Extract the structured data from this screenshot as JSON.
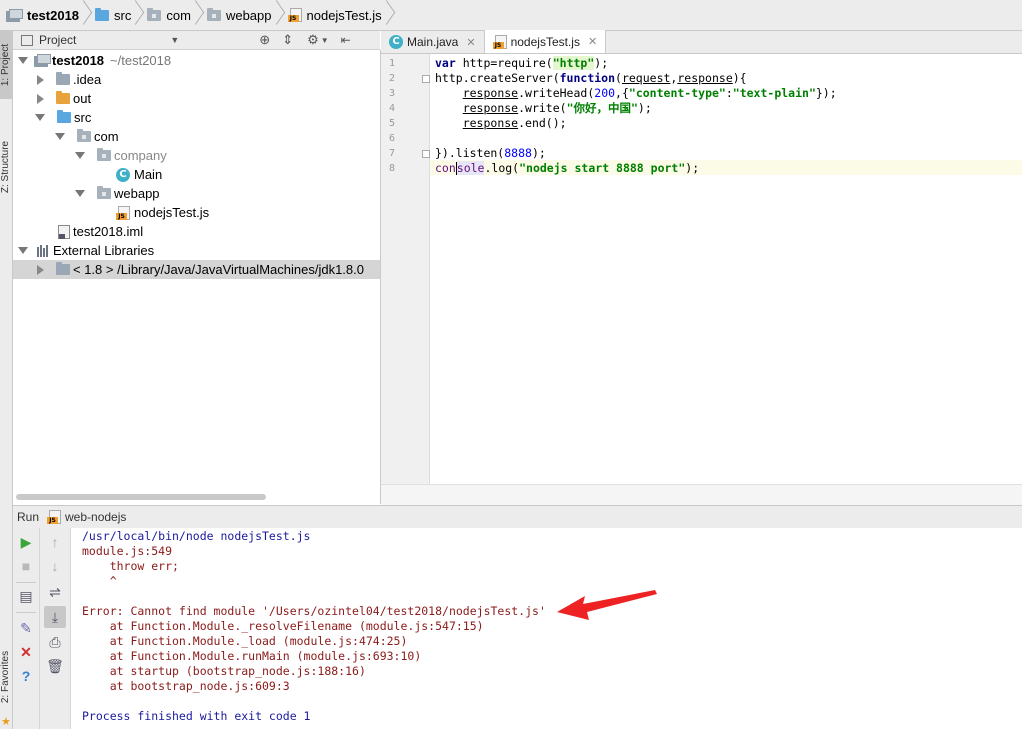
{
  "breadcrumb": {
    "items": [
      {
        "label": "test2018",
        "icon": "project-icon"
      },
      {
        "label": "src",
        "icon": "folder-icon"
      },
      {
        "label": "com",
        "icon": "package-icon"
      },
      {
        "label": "webapp",
        "icon": "package-icon"
      },
      {
        "label": "nodejsTest.js",
        "icon": "js-file-icon"
      }
    ]
  },
  "left_stripe": {
    "project_tab": "1: Project",
    "structure_tab": "Z: Structure",
    "favorites_tab": "2: Favorites"
  },
  "project_panel": {
    "title": "Project",
    "tree": [
      {
        "label": "test2018",
        "suffix": "~/test2018",
        "level": 0,
        "expanded": true,
        "icon": "project-icon"
      },
      {
        "label": ".idea",
        "level": 1,
        "expanded": false,
        "icon": "folder-icon"
      },
      {
        "label": "out",
        "level": 1,
        "expanded": false,
        "icon": "folder-orange-icon"
      },
      {
        "label": "src",
        "level": 1,
        "expanded": true,
        "icon": "folder-blue-icon"
      },
      {
        "label": "com",
        "level": 2,
        "expanded": true,
        "icon": "package-icon"
      },
      {
        "label": "company",
        "level": 3,
        "expanded": true,
        "icon": "package-icon"
      },
      {
        "label": "Main",
        "level": 4,
        "icon": "class-icon"
      },
      {
        "label": "webapp",
        "level": 3,
        "expanded": true,
        "icon": "package-icon"
      },
      {
        "label": "nodejsTest.js",
        "level": 4,
        "icon": "js-file-icon"
      },
      {
        "label": "test2018.iml",
        "level": 1,
        "icon": "iml-file-icon"
      },
      {
        "label": "External Libraries",
        "level": 0,
        "expanded": true,
        "icon": "library-icon"
      },
      {
        "label": "< 1.8 >  /Library/Java/JavaVirtualMachines/jdk1.8.0",
        "level": 1,
        "expanded": false,
        "icon": "folder-icon",
        "selected": true
      }
    ]
  },
  "editor": {
    "tabs": [
      {
        "label": "Main.java",
        "active": false
      },
      {
        "label": "nodejsTest.js",
        "active": true
      }
    ],
    "line_numbers": [
      "1",
      "2",
      "3",
      "4",
      "5",
      "6",
      "7",
      "8"
    ],
    "code": {
      "l1_var": "var",
      "l1_http": " http=require(",
      "l1_str": "\"http\"",
      "l1_end": ");",
      "l2_a": "http.createServer(",
      "l2_fn": "function",
      "l2_b": "(",
      "l2_req": "request",
      "l2_c": ",",
      "l2_res": "response",
      "l2_d": "){",
      "l3_obj": "response",
      "l3_m": ".writeHead(",
      "l3_num": "200",
      "l3_b": ",{",
      "l3_k": "\"content-type\"",
      "l3_colon": ":",
      "l3_v": "\"text-plain\"",
      "l3_end": "});",
      "l4_obj": "response",
      "l4_m": ".write(",
      "l4_str": "\"你好，中国\"",
      "l4_end": ");",
      "l5_obj": "response",
      "l5_m": ".end();",
      "l7_a": "}).listen(",
      "l7_num": "8888",
      "l7_end": ");",
      "l8_a": "con",
      "l8_b": "sole",
      "l8_c": ".log(",
      "l8_str": "\"nodejs start 8888 port\"",
      "l8_end": ");"
    }
  },
  "run_panel": {
    "title": "Run",
    "config": "web-nodejs",
    "output": [
      {
        "text": "/usr/local/bin/node nodejsTest.js",
        "kind": "cmd"
      },
      {
        "text": "module.js:549",
        "kind": "err"
      },
      {
        "text": "    throw err;",
        "kind": "err"
      },
      {
        "text": "    ^",
        "kind": "err"
      },
      {
        "text": "",
        "kind": "err"
      },
      {
        "text": "Error: Cannot find module '/Users/ozintel04/test2018/nodejsTest.js'",
        "kind": "err"
      },
      {
        "text": "    at Function.Module._resolveFilename (module.js:547:15)",
        "kind": "err"
      },
      {
        "text": "    at Function.Module._load (module.js:474:25)",
        "kind": "err"
      },
      {
        "text": "    at Function.Module.runMain (module.js:693:10)",
        "kind": "err"
      },
      {
        "text": "    at startup (bootstrap_node.js:188:16)",
        "kind": "err"
      },
      {
        "text": "    at bootstrap_node.js:609:3",
        "kind": "err"
      },
      {
        "text": "",
        "kind": "err"
      },
      {
        "text": "Process finished with exit code 1",
        "kind": "fin"
      }
    ]
  },
  "colors": {
    "annotation_arrow": "#ee2222",
    "error_text": "#8b1a1a",
    "command_text": "#1a1a9e"
  }
}
